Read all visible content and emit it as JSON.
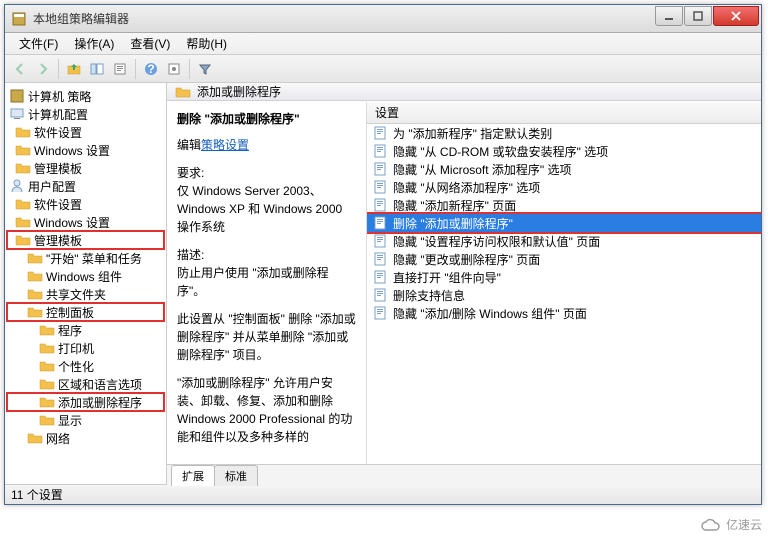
{
  "title": "本地组策略编辑器",
  "menu": {
    "file": "文件(F)",
    "action": "操作(A)",
    "view": "查看(V)",
    "help": "帮助(H)"
  },
  "tree": {
    "root": "计算机 策略",
    "computer": "计算机配置",
    "c_software": "软件设置",
    "c_windows": "Windows 设置",
    "c_admin": "管理模板",
    "user": "用户配置",
    "u_software": "软件设置",
    "u_windows": "Windows 设置",
    "u_admin": "管理模板",
    "start_menu": "\"开始\" 菜单和任务",
    "win_comp": "Windows 组件",
    "shared": "共享文件夹",
    "ctrl_panel": "控制面板",
    "programs": "程序",
    "printers": "打印机",
    "personalize": "个性化",
    "region": "区域和语言选项",
    "addremove": "添加或删除程序",
    "display": "显示",
    "network": "网络"
  },
  "header_title": "添加或删除程序",
  "desc": {
    "title": "删除 \"添加或删除程序\"",
    "edit_link_pre": "编辑",
    "edit_link": "策略设置",
    "req_label": "要求:",
    "req_text": "仅 Windows Server 2003、Windows XP 和 Windows 2000 操作系统",
    "desc_label": "描述:",
    "desc_text": "防止用户使用 \"添加或删除程序\"。",
    "para1": "此设置从 \"控制面板\" 删除 \"添加或删除程序\" 并从菜单删除 \"添加或删除程序\" 项目。",
    "para2": "\"添加或删除程序\" 允许用户安装、卸载、修复、添加和删除 Windows 2000 Professional 的功能和组件以及多种多样的"
  },
  "list_header": "设置",
  "settings": [
    "为 \"添加新程序\" 指定默认类别",
    "隐藏 \"从 CD-ROM 或软盘安装程序\" 选项",
    "隐藏 \"从 Microsoft 添加程序\" 选项",
    "隐藏 \"从网络添加程序\" 选项",
    "隐藏 \"添加新程序\" 页面",
    "删除 \"添加或删除程序\"",
    "隐藏 \"设置程序访问权限和默认值\" 页面",
    "隐藏 \"更改或删除程序\" 页面",
    "直接打开 \"组件向导\"",
    "删除支持信息",
    "隐藏 \"添加/删除 Windows 组件\" 页面"
  ],
  "selected_index": 5,
  "tabs": {
    "ext": "扩展",
    "std": "标准"
  },
  "status": "11 个设置",
  "watermark": "亿速云"
}
